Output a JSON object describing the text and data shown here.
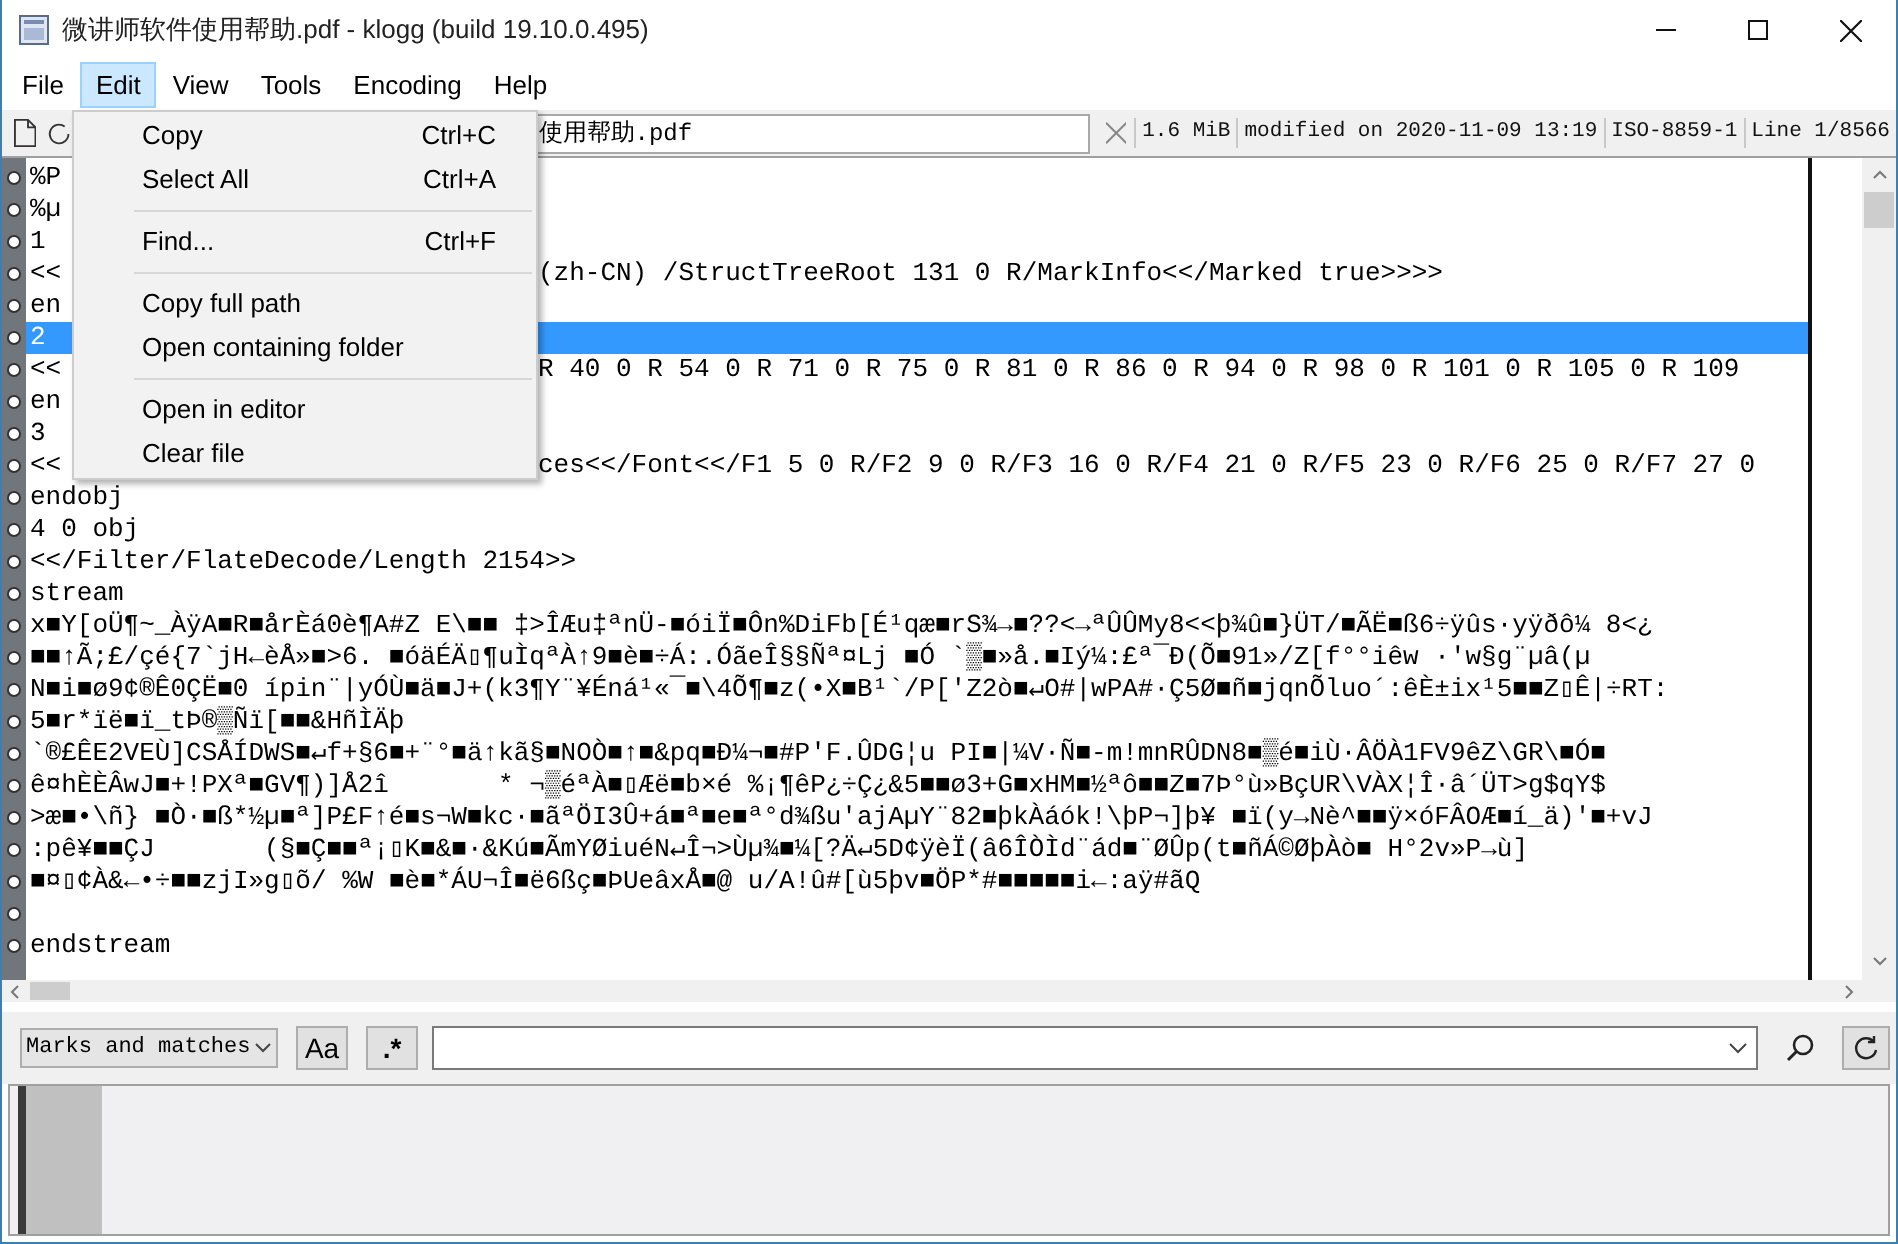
{
  "window": {
    "title": "微讲师软件使用帮助.pdf - klogg (build 19.10.0.495)"
  },
  "menu_bar": [
    {
      "label": "File",
      "selected": false
    },
    {
      "label": "Edit",
      "selected": true
    },
    {
      "label": "View",
      "selected": false
    },
    {
      "label": "Tools",
      "selected": false
    },
    {
      "label": "Encoding",
      "selected": false
    },
    {
      "label": "Help",
      "selected": false
    }
  ],
  "edit_menu": [
    [
      {
        "label": "Copy",
        "shortcut": "Ctrl+C"
      },
      {
        "label": "Select All",
        "shortcut": "Ctrl+A"
      }
    ],
    [
      {
        "label": "Find...",
        "shortcut": "Ctrl+F"
      }
    ],
    [
      {
        "label": "Copy full path"
      },
      {
        "label": "Open containing folder"
      }
    ],
    [
      {
        "label": "Open in editor"
      },
      {
        "label": "Clear file"
      }
    ]
  ],
  "file_path": "使用帮助.pdf",
  "status": [
    "1.6 MiB",
    "modified on 2020-11-09 13:19",
    "ISO-8859-1",
    "Line 1/8566"
  ],
  "lines": [
    {
      "text": "%P",
      "selected": false
    },
    {
      "text": "%µ",
      "selected": false
    },
    {
      "text": "1",
      "selected": false
    },
    {
      "text": "<<",
      "tail": "(zh-CN) /StructTreeRoot 131 0 R/MarkInfo<</Marked true>>>>",
      "selected": false
    },
    {
      "text": "en",
      "selected": false
    },
    {
      "text": "2",
      "selected": true
    },
    {
      "text": "<<",
      "tail": "R 40 0 R 54 0 R 71 0 R 75 0 R 81 0 R 86 0 R 94 0 R 98 0 R 101 0 R 105 0 R 109",
      "selected": false
    },
    {
      "text": "en",
      "selected": false
    },
    {
      "text": "3",
      "selected": false
    },
    {
      "text": "<<",
      "tail": "ces<</Font<</F1 5 0 R/F2 9 0 R/F3 16 0 R/F4 21 0 R/F5 23 0 R/F6 25 0 R/F7 27 0",
      "selected": false
    },
    {
      "text": "endobj",
      "selected": false
    },
    {
      "text": "4 0 obj",
      "selected": false
    },
    {
      "text": "<</Filter/FlateDecode/Length 2154>>",
      "selected": false
    },
    {
      "text": "stream",
      "selected": false
    },
    {
      "text": "x■Y[oÜ¶~_ÀÿA■R■årÈá0è¶A#Z E\\■■ ‡>ÎÆu‡ªnÜ-■óiÏ■Ôn%DiFb[É¹qæ■rS¾→■??<→ªÛÛMy8<<þ¾û■}ÜT/■ÃË■ß6÷ÿûs·yÿðô¼ 8<¿",
      "selected": false
    },
    {
      "text": "■■↑Ã;£/çé{7`jH←èÅ»■>6. ■óäÉÄ▯¶uÌqªÀ↑9■è■÷Á:.ÓãeÎ§§Ñª¤Lj ■Ó `▒■»å.■Iý¼:£ª¯Ð(Õ■91»/Z[f°°iêw ·'w§g¨µâ(µ",
      "selected": false
    },
    {
      "text": "N■i■ø9¢®Ê0ÇË■0 ípin¨|yÓÙ■ä■J+(k3¶Y¨¥Éná¹«¯■\\4Õ¶■z(•X■B¹`/P['Z2ò■↵O#|wPA#·Ç5Ø■ñ■jqnÕluo´:êÈ±ix¹5■■Z▯Ê|÷RT:",
      "selected": false
    },
    {
      "text": "5■r*ïë■ï_tÞ®▒Ñï[■■&HñÌÄþ",
      "selected": false
    },
    {
      "text": "`®£ÊE2VEÙ]CSÅÍDWS■↵f+§6■+¨°■ä↑kã§■NOÒ■↑■&pq■Ð¼¬■#P'F.ÛDG¦u PI■|¼V·Ñ■-m!mnRÛDN8■▒é■iÙ·ÂÖÀ1FV9êZ\\GR\\■Ó■",
      "selected": false
    },
    {
      "text": "ê¤hÈÈÂwJ■+!PXª■GV¶)]Å2î       * ¬▒éªÀ■▯Æë■b×é %¡¶êP¿÷Ç¿&5■■ø3+G■xHM■½ªô■■Z■7Þ°ù»BçUR\\VÀX¦Î·â´ÜT>g$qY$",
      "selected": false
    },
    {
      "text": ">æ■•\\ñ} ■Ò·■ß*½µ■ª]P£F↑é■s¬W■kc·■ãªÖI3Û+á■ª■e■ª°d¾ßu'ajAµY¨82■þkÀáók!\\þP¬]þ¥ ■ï(y→Nè^■■ÿ×óFÂOÆ■í_ä)'■+vJ",
      "selected": false
    },
    {
      "text": ":pê¥■■ÇJ       (§■Ç■■ª¡▯K■&■·&Kú■ÃmYØiuéN↵Î¬>Ùµ¾■¼[?Ä↵5D¢ÿèÏ(â6ÎÒÌd¨ád■¨ØÛp(t■ñÁ©ØþÀò■ H°2v»P→ù]",
      "selected": false
    },
    {
      "text": "■¤▯¢À&←•÷■■zjI»g▯õ/ %W ■è■*ÁU¬Î■ë6ßç■ÞUeâxÅ■@ u/A!û#[ù5þv■ÖP*#■■■■■i←:aÿ#ãQ",
      "selected": false
    },
    {
      "selected": false
    },
    {
      "text": "endstream",
      "selected": false
    }
  ],
  "search_bar": {
    "filter": "Marks and matches",
    "case_button": "Aa",
    "regex_button": ".*"
  }
}
